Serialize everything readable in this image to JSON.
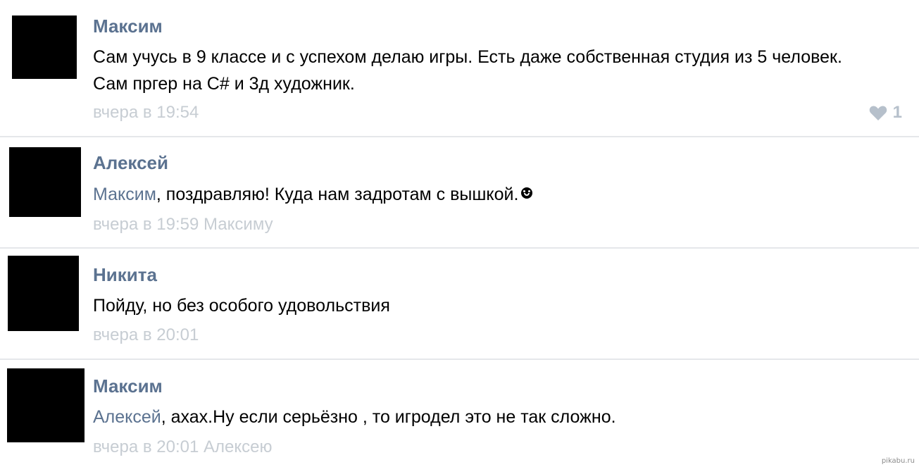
{
  "comments": [
    {
      "author": "Максим",
      "mention": "",
      "text": "Сам учусь в 9 классе и с успехом делаю игры. Есть даже собственная студия из 5 человек. Сам пргер на C# и 3д художник.",
      "time": "вчера в 19:54",
      "reply_to": "",
      "likes": "1"
    },
    {
      "author": "Алексей",
      "mention": "Максим",
      "text": ", поздравляю! Куда нам задротам с вышкой.",
      "time": "вчера в 19:59",
      "reply_to": "Максиму"
    },
    {
      "author": "Никита",
      "mention": "",
      "text": "Пойду, но без особого удовольствия",
      "time": "вчера в 20:01",
      "reply_to": ""
    },
    {
      "author": "Максим",
      "mention": "Алексей",
      "text": ", ахах.Ну если серьёзно , то игродел это не так сложно.",
      "time": "вчера в 20:01",
      "reply_to": "Алексею"
    }
  ],
  "icons": {
    "like": "heart-icon",
    "emoji": "smiley-icon"
  },
  "colors": {
    "author": "#5b7290",
    "meta": "#c7cdd3",
    "like": "#b6c0cb"
  },
  "watermark": "pikabu.ru"
}
